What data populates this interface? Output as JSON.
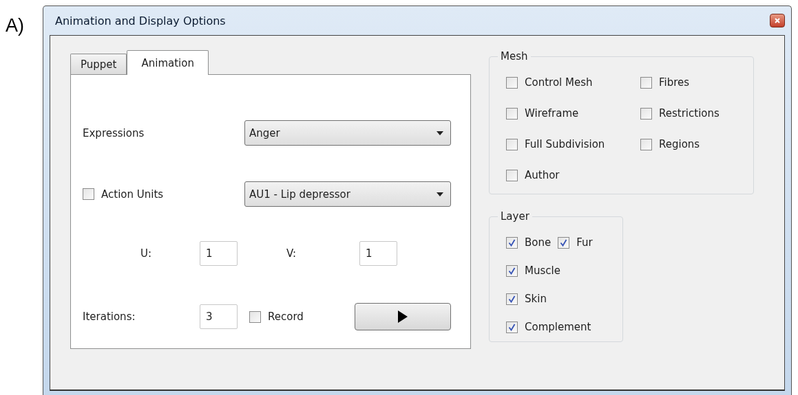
{
  "figure_label": "A)",
  "window": {
    "title": "Animation and Display Options"
  },
  "tabs": [
    {
      "label": "Puppet",
      "selected": false
    },
    {
      "label": "Animation",
      "selected": true
    }
  ],
  "animation": {
    "expressions": {
      "label": "Expressions",
      "value": "Anger"
    },
    "action_units": {
      "label": "Action Units",
      "checked": false,
      "value": "AU1 - Lip depressor"
    },
    "u": {
      "label": "U:",
      "value": "1"
    },
    "v": {
      "label": "V:",
      "value": "1"
    },
    "iterations": {
      "label": "Iterations:",
      "value": "3"
    },
    "record": {
      "label": "Record",
      "checked": false
    }
  },
  "mesh": {
    "title": "Mesh",
    "items": [
      {
        "label": "Control Mesh",
        "checked": false
      },
      {
        "label": "Fibres",
        "checked": false
      },
      {
        "label": "Wireframe",
        "checked": false
      },
      {
        "label": "Restrictions",
        "checked": false
      },
      {
        "label": "Full Subdivision",
        "checked": false
      },
      {
        "label": "Regions",
        "checked": false
      },
      {
        "label": "Author",
        "checked": false
      }
    ]
  },
  "layer": {
    "title": "Layer",
    "rows": [
      [
        {
          "label": "Bone",
          "checked": true
        },
        {
          "label": "Fur",
          "checked": true
        }
      ],
      [
        {
          "label": "Muscle",
          "checked": true
        }
      ],
      [
        {
          "label": "Skin",
          "checked": true
        }
      ],
      [
        {
          "label": "Complement",
          "checked": true
        }
      ]
    ]
  }
}
